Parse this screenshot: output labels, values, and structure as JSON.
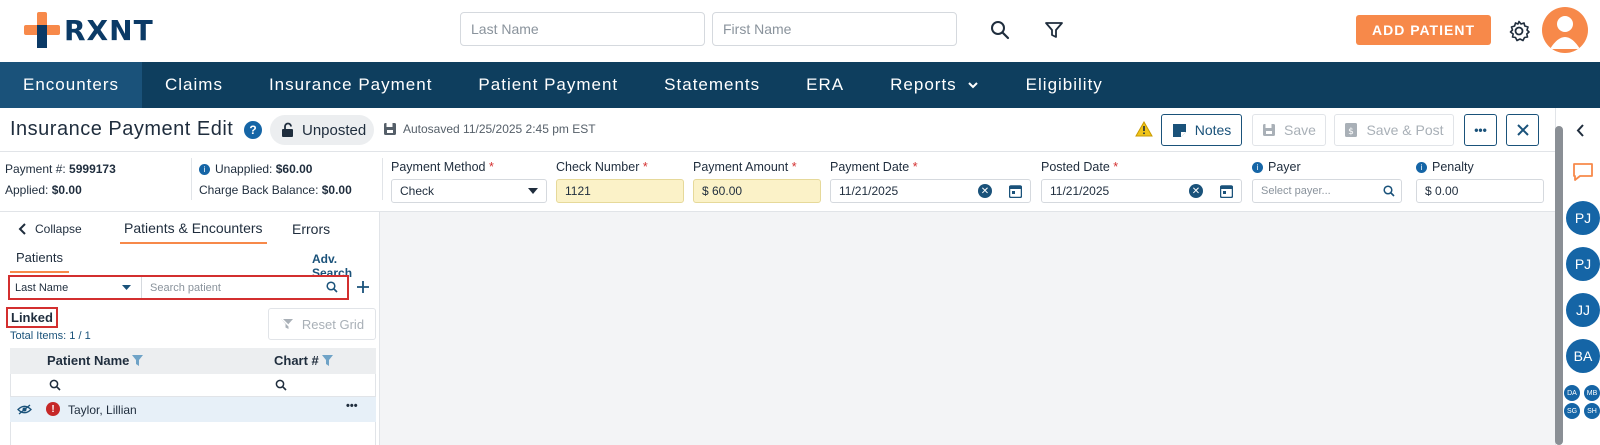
{
  "brand": {
    "name": "RXNT",
    "accent": "#f7894a",
    "navy": "#0e3e5e"
  },
  "top": {
    "last_name_placeholder": "Last Name",
    "first_name_placeholder": "First Name",
    "add_patient_label": "ADD PATIENT"
  },
  "nav": {
    "items": [
      "Encounters",
      "Claims",
      "Insurance Payment",
      "Patient Payment",
      "Statements",
      "ERA",
      "Reports",
      "Eligibility"
    ]
  },
  "header": {
    "title": "Insurance Payment Edit",
    "status": "Unposted",
    "autosaved": "Autosaved 11/25/2025 2:45 pm EST",
    "notes_label": "Notes",
    "save_label": "Save",
    "save_post_label": "Save & Post",
    "more_label": "•••"
  },
  "payment": {
    "payment_no_label": "Payment #:",
    "payment_no": "5999173",
    "applied_label": "Applied:",
    "applied": "$0.00",
    "unapplied_label": "Unapplied:",
    "unapplied": "$60.00",
    "chargeback_label": "Charge Back Balance:",
    "chargeback": "$0.00",
    "method_label": "Payment Method",
    "method_value": "Check",
    "check_label": "Check Number",
    "check_value": "1121",
    "amount_label": "Payment Amount",
    "amount_value": "$ 60.00",
    "date_label": "Payment Date",
    "date_value": "11/21/2025",
    "posted_label": "Posted Date",
    "posted_value": "11/21/2025",
    "payer_label": "Payer",
    "payer_placeholder": "Select payer...",
    "penalty_label": "Penalty",
    "penalty_value": "$ 0.00",
    "required_mark": "*"
  },
  "left": {
    "collapse_label": "Collapse",
    "tab_patients_encounters": "Patients & Encounters",
    "tab_errors": "Errors",
    "subtab_patients": "Patients",
    "adv_search": "Adv. Search",
    "search_by": "Last Name",
    "search_placeholder": "Search patient",
    "linked_label": "Linked",
    "total_items": "Total Items: 1 / 1",
    "reset_grid": "Reset Grid",
    "col_patient_name": "Patient Name",
    "col_chart": "Chart #",
    "row_name": "Taylor, Lillian",
    "row_more": "•••"
  },
  "sidebar": {
    "avatars": [
      "PJ",
      "PJ",
      "JJ",
      "BA"
    ],
    "mini_avatars": [
      "DA",
      "MB",
      "SG",
      "SH"
    ]
  }
}
